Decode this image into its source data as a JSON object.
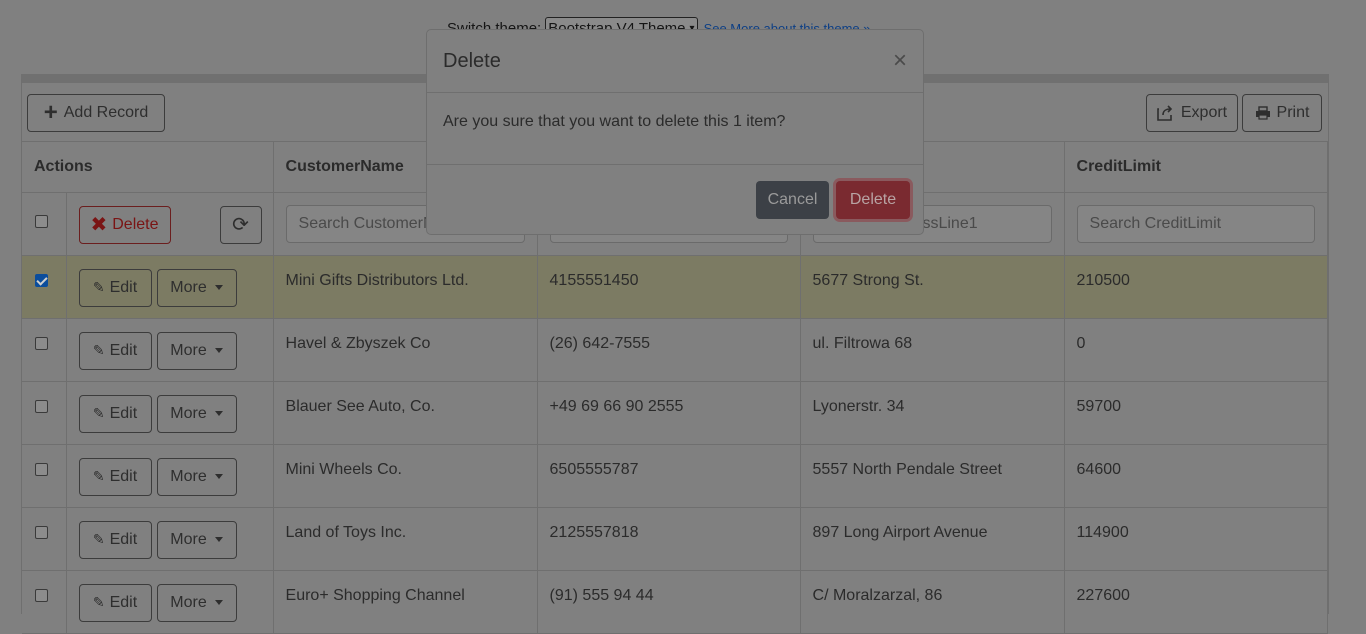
{
  "theme": {
    "label": "Switch theme:",
    "selected": "Bootstrap V4 Theme",
    "link": "See More about this theme »"
  },
  "toolbar": {
    "add_label": "Add Record",
    "export_label": "Export",
    "print_label": "Print"
  },
  "table": {
    "headers": [
      "Actions",
      "CustomerName",
      "",
      "",
      "CreditLimit"
    ],
    "search_placeholders": [
      "Search CustomerN",
      "",
      "Search AddressLine1",
      "Search CreditLimit"
    ],
    "delete_label": "Delete",
    "edit_label": "Edit",
    "more_label": "More",
    "rows": [
      {
        "checked": true,
        "name": "Mini Gifts Distributors Ltd.",
        "phone": "4155551450",
        "address": "5677 Strong St.",
        "credit": "210500"
      },
      {
        "checked": false,
        "name": "Havel & Zbyszek Co",
        "phone": "(26) 642-7555",
        "address": "ul. Filtrowa 68",
        "credit": "0"
      },
      {
        "checked": false,
        "name": "Blauer See Auto, Co.",
        "phone": "+49 69 66 90 2555",
        "address": "Lyonerstr. 34",
        "credit": "59700"
      },
      {
        "checked": false,
        "name": "Mini Wheels Co.",
        "phone": "6505555787",
        "address": "5557 North Pendale Street",
        "credit": "64600"
      },
      {
        "checked": false,
        "name": "Land of Toys Inc.",
        "phone": "2125557818",
        "address": "897 Long Airport Avenue",
        "credit": "114900"
      },
      {
        "checked": false,
        "name": "Euro+ Shopping Channel",
        "phone": "(91) 555 94 44",
        "address": "C/ Moralzarzal, 86",
        "credit": "227600"
      }
    ]
  },
  "modal": {
    "title": "Delete",
    "close": "×",
    "message": "Are you sure that you want to delete this 1 item?",
    "cancel_label": "Cancel",
    "delete_label": "Delete"
  }
}
